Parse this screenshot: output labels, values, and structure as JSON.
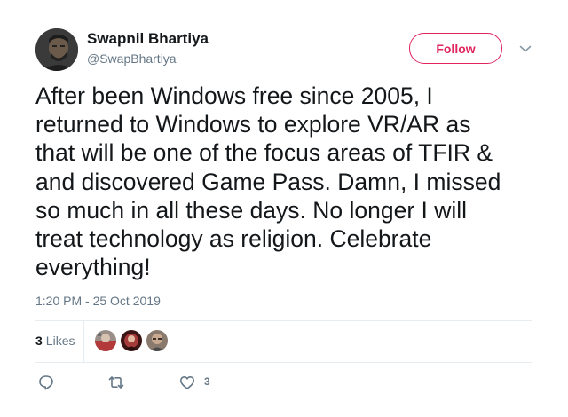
{
  "author": {
    "display_name": "Swapnil Bhartiya",
    "handle": "@SwapBhartiya"
  },
  "follow_label": "Follow",
  "tweet_lines": [
    "After been Windows free since 2005, I",
    "returned to Windows to explore VR/AR as",
    "that will be one of the focus areas of TFIR &",
    "and discovered Game Pass. Damn, I missed",
    "so much in all these days. No longer I will",
    "treat technology as religion. Celebrate",
    "everything!"
  ],
  "timestamp": "1:20 PM - 25 Oct 2019",
  "likes": {
    "count": "3",
    "label": "Likes"
  },
  "actions": {
    "like_count": "3"
  },
  "icons": {
    "menu": "chevron-down-icon",
    "reply": "reply-icon",
    "retweet": "retweet-icon",
    "like": "heart-icon"
  },
  "colors": {
    "follow_accent": "#e0245e",
    "secondary_text": "#657786",
    "primary_text": "#14171a",
    "divider": "#e6ecf0",
    "icon": "#657786"
  }
}
